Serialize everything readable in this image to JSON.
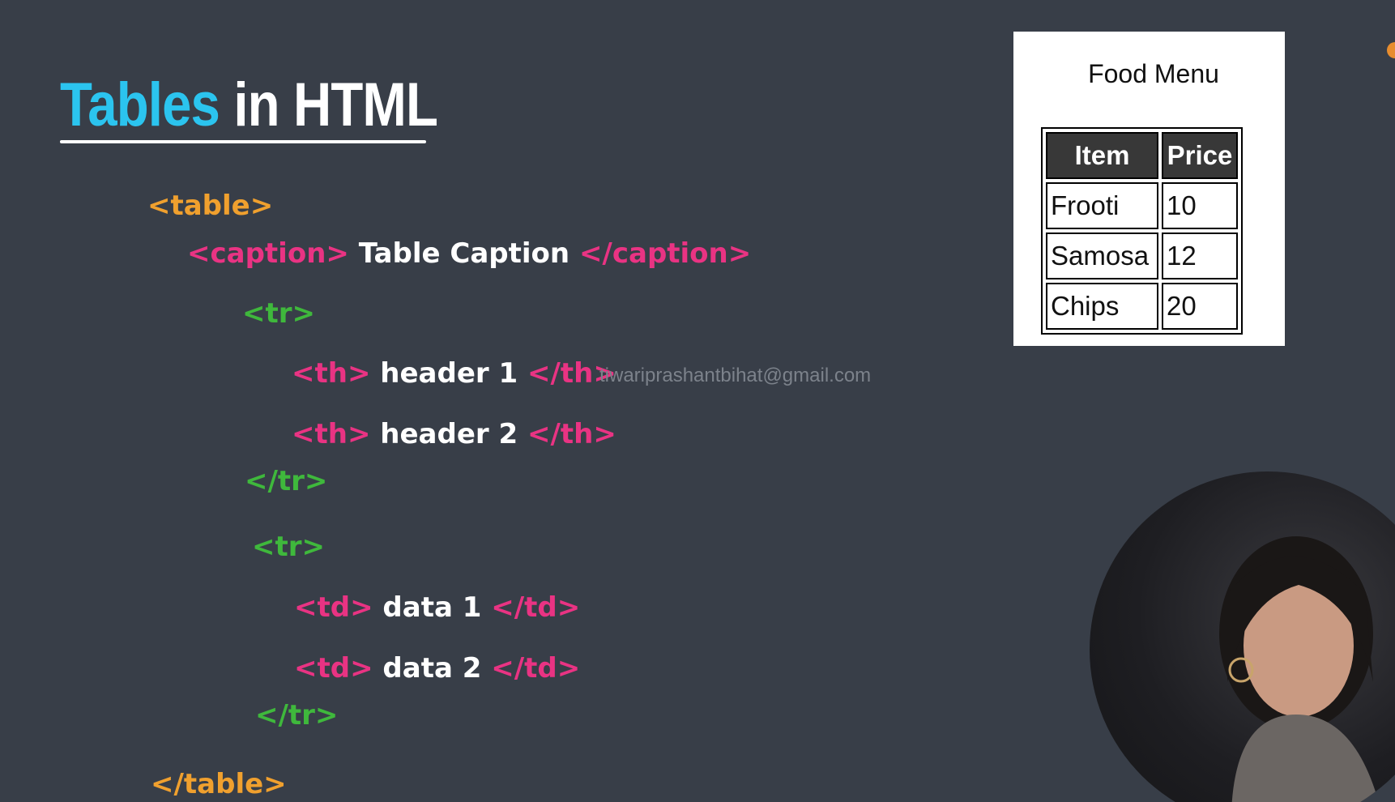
{
  "slide": {
    "title_part1": "Tables",
    "title_part2": "in HTML",
    "email": "tiwariprashantbihat@gmail.com"
  },
  "code": {
    "table_open": "<table>",
    "caption_open": "<caption>",
    "caption_text": "Table Caption",
    "caption_close": "</caption>",
    "tr_open_1": "<tr>",
    "th_open_1": "<th>",
    "th_text_1": "header 1",
    "th_close_1": "</th>",
    "th_open_2": "<th>",
    "th_text_2": "header 2",
    "th_close_2": "</th>",
    "tr_close_1": "</tr>",
    "tr_open_2": "<tr>",
    "td_open_1": "<td>",
    "td_text_1": "data 1",
    "td_close_1": "</td>",
    "td_open_2": "<td>",
    "td_text_2": "data 2",
    "td_close_2": "</td>",
    "tr_close_2": "</tr>",
    "table_close": "</table>"
  },
  "preview": {
    "caption": "Food Menu",
    "headers": [
      "Item",
      "Price"
    ],
    "rows": [
      [
        "Frooti",
        "10"
      ],
      [
        "Samosa",
        "12"
      ],
      [
        "Chips",
        "20"
      ]
    ]
  },
  "colors": {
    "background": "#383e48",
    "title_accent": "#2bc4ef",
    "tag_orange": "#f0a02e",
    "tag_pink": "#e93383",
    "tag_green": "#3fb83c"
  }
}
